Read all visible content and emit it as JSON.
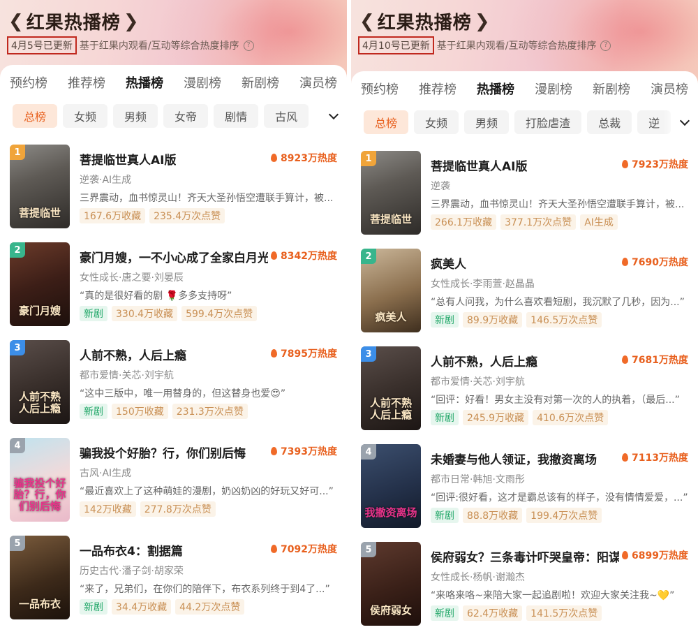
{
  "colors": {
    "accent": "#e8601e",
    "date_box_border": "#c0281e",
    "new_tag": "#23a86a"
  },
  "left": {
    "title": "红果热播榜",
    "date": "4月5号已更新",
    "subtitle": "基于红果内观看/互动等综合热度排序",
    "tabs": [
      "预约榜",
      "推荐榜",
      "热播榜",
      "漫剧榜",
      "新剧榜",
      "演员榜"
    ],
    "active_tab": "热播榜",
    "chips": [
      "总榜",
      "女频",
      "男频",
      "女帝",
      "剧情",
      "古风"
    ],
    "items": [
      {
        "rank": "1",
        "name": "菩提临世真人AI版",
        "heat": "8923万热度",
        "tags": "逆袭·AI生成",
        "quote": "三界震动，血书惊灵山！齐天大圣孙悟空遭联手算计，被...",
        "stats": [
          "167.6万收藏",
          "235.4万次点赞"
        ],
        "new": "",
        "poster_text": "菩提临世",
        "rank_color": "#f0a43a",
        "poster_bg": "linear-gradient(160deg,#8c8a86 0%,#5e5a55 40%,#2e2b28 100%)"
      },
      {
        "rank": "2",
        "name": "豪门月嫂，一不小心成了全家白月光",
        "heat": "8342万热度",
        "tags": "女性成长·唐之要·刘晏辰",
        "quote": "“真的是很好看的剧 🌹多多支持呀”",
        "stats": [
          "330.4万收藏",
          "599.4万次点赞"
        ],
        "new": "新剧",
        "poster_text": "豪门月嫂",
        "rank_color": "#38b58c",
        "poster_bg": "linear-gradient(160deg,#6b3b2a 0%,#3c1e17 50%,#1d100c 100%)"
      },
      {
        "rank": "3",
        "name": "人前不熟，人后上瘾",
        "heat": "7895万热度",
        "tags": "都市爱情·关芯·刘宇航",
        "quote": "“这中三版中，唯一用替身的，但这替身也爱😍”",
        "stats": [
          "150万收藏",
          "231.3万次点赞"
        ],
        "new": "新剧",
        "poster_text": "人前不熟 人后上瘾",
        "rank_color": "#3c8ee8",
        "poster_bg": "linear-gradient(160deg,#5a4e4a 0%,#3a302c 50%,#1c1614 100%)"
      },
      {
        "rank": "4",
        "name": "骗我投个好胎？行，你们别后悔",
        "heat": "7393万热度",
        "tags": "古风·AI生成",
        "quote": "“最近喜欢上了这种萌娃的漫剧，奶凶奶凶的好玩又好可...”",
        "stats": [
          "142万收藏",
          "277.8万次点赞"
        ],
        "new": "",
        "poster_text": "骗我投个好胎？行，你们别后悔",
        "rank_color": "#9aa3ad",
        "poster_bg": "linear-gradient(160deg,#bfe3ef 0%,#f4d9d9 55%,#e9b9c9 100%)"
      },
      {
        "rank": "5",
        "name": "一品布衣4：割据篇",
        "heat": "7092万热度",
        "tags": "历史古代·潘子剑·胡家荣",
        "quote": "“来了，兄弟们，在你们的陪伴下，布衣系列终于到4了...”",
        "stats": [
          "34.4万收藏",
          "44.2万次点赞"
        ],
        "new": "新剧",
        "poster_text": "一品布衣",
        "rank_color": "#9aa3ad",
        "poster_bg": "linear-gradient(160deg,#7a5b3c 0%,#3d2a1a 55%,#1c120b 100%)"
      }
    ]
  },
  "right": {
    "title": "红果热播榜",
    "date": "4月10号已更新",
    "subtitle": "基于红果内观看/互动等综合热度排序",
    "tabs": [
      "预约榜",
      "推荐榜",
      "热播榜",
      "漫剧榜",
      "新剧榜",
      "演员榜"
    ],
    "active_tab": "热播榜",
    "chips": [
      "总榜",
      "女频",
      "男频",
      "打脸虐渣",
      "总裁",
      "逆"
    ],
    "items": [
      {
        "rank": "1",
        "name": "菩提临世真人AI版",
        "heat": "7923万热度",
        "tags": "逆袭",
        "quote": "三界震动，血书惊灵山！齐天大圣孙悟空遭联手算计，被...",
        "stats": [
          "266.1万收藏",
          "377.1万次点赞",
          "AI生成"
        ],
        "new": "",
        "poster_text": "菩提临世",
        "rank_color": "#f0a43a",
        "poster_bg": "linear-gradient(160deg,#8c8a86 0%,#5e5a55 40%,#2e2b28 100%)"
      },
      {
        "rank": "2",
        "name": "疯美人",
        "heat": "7690万热度",
        "tags": "女性成长·李雨萱·赵晶晶",
        "quote": "“总有人问我，为什么喜欢看短剧，我沉默了几秒，因为...”",
        "stats": [
          "89.9万收藏",
          "146.5万次点赞"
        ],
        "new": "新剧",
        "poster_text": "疯美人",
        "rank_color": "#38b58c",
        "poster_bg": "linear-gradient(160deg,#cbb79a 0%,#8a6e4d 55%,#3e2e1e 100%)"
      },
      {
        "rank": "3",
        "name": "人前不熟，人后上瘾",
        "heat": "7681万热度",
        "tags": "都市爱情·关芯·刘宇航",
        "quote": "“回评：好看！男女主没有对第一次的人的执着，（最后...”",
        "stats": [
          "245.9万收藏",
          "410.6万次点赞"
        ],
        "new": "新剧",
        "poster_text": "人前不熟 人后上瘾",
        "rank_color": "#3c8ee8",
        "poster_bg": "linear-gradient(160deg,#5a4e4a 0%,#3a302c 50%,#1c1614 100%)"
      },
      {
        "rank": "4",
        "name": "未婚妻与他人领证，我撤资离场",
        "heat": "7113万热度",
        "tags": "都市日常·韩旭·文雨彤",
        "quote": "“回评:很好看，这才是霸总该有的样子，没有情情爱爱，...”",
        "stats": [
          "88.8万收藏",
          "199.4万次点赞"
        ],
        "new": "新剧",
        "poster_text": "我撤资离场",
        "rank_color": "#9aa3ad",
        "poster_bg": "linear-gradient(160deg,#3c4f6e 0%,#24314a 55%,#121a29 100%)"
      },
      {
        "rank": "5",
        "name": "侯府弱女？三条毒计吓哭皇帝：阳谋",
        "heat": "6899万热度",
        "tags": "女性成长·杨帆·谢瀚杰",
        "quote": "“来咯来咯~来陪大家一起追剧啦！欢迎大家关注我~💛”",
        "stats": [
          "62.4万收藏",
          "141.5万次点赞"
        ],
        "new": "新剧",
        "poster_text": "侯府弱女",
        "rank_color": "#9aa3ad",
        "poster_bg": "linear-gradient(160deg,#5e3a2e 0%,#3a2018 55%,#1e0f0b 100%)"
      }
    ]
  }
}
